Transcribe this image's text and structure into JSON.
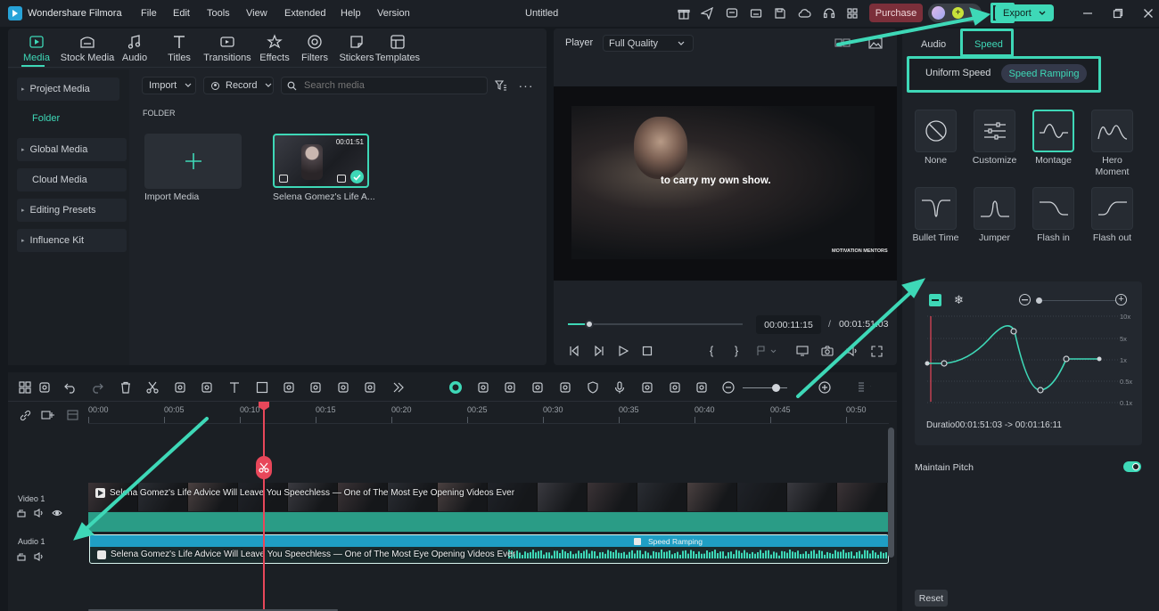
{
  "app": {
    "name": "Wondershare Filmora",
    "project_title": "Untitled"
  },
  "menu": [
    "File",
    "Edit",
    "Tools",
    "View",
    "Extended",
    "Help",
    "Version"
  ],
  "titlebar": {
    "purchase_label": "Purchase",
    "export_label": "Export"
  },
  "media_tabs": [
    {
      "label": "Media",
      "icon": "media-icon",
      "active": true
    },
    {
      "label": "Stock Media",
      "icon": "stock-media-icon"
    },
    {
      "label": "Audio",
      "icon": "audio-note-icon"
    },
    {
      "label": "Titles",
      "icon": "titles-icon"
    },
    {
      "label": "Transitions",
      "icon": "transitions-icon"
    },
    {
      "label": "Effects",
      "icon": "effects-icon"
    },
    {
      "label": "Filters",
      "icon": "filters-icon"
    },
    {
      "label": "Stickers",
      "icon": "stickers-icon"
    },
    {
      "label": "Templates",
      "icon": "templates-icon"
    }
  ],
  "sidebar": {
    "items": [
      {
        "label": "Project Media",
        "expandable": true
      },
      {
        "label": "Folder",
        "active": true
      },
      {
        "label": "Global Media",
        "expandable": true
      },
      {
        "label": "Cloud Media"
      },
      {
        "label": "Editing Presets",
        "expandable": true
      },
      {
        "label": "Influence Kit",
        "expandable": true
      }
    ]
  },
  "media_toolbar": {
    "import_label": "Import",
    "record_label": "Record",
    "search_placeholder": "Search media"
  },
  "folder_label": "FOLDER",
  "media_items": [
    {
      "label": "Import Media"
    },
    {
      "label": "Selena Gomez's Life A...",
      "duration": "00:01:51"
    }
  ],
  "player": {
    "label": "Player",
    "quality": "Full Quality",
    "subtitle": "to carry my own show.",
    "watermark": "MOTIVATION MENTORS",
    "current_time": "00:00:11:15",
    "separator": "/",
    "total_time": "00:01:51:03",
    "progress": 0.12
  },
  "right_panel": {
    "tabs": [
      {
        "label": "Audio"
      },
      {
        "label": "Speed",
        "active": true
      }
    ],
    "speed_modes": [
      {
        "label": "Uniform Speed"
      },
      {
        "label": "Speed Ramping",
        "active": true
      }
    ],
    "presets": [
      {
        "label": "None",
        "icon": "none-icon"
      },
      {
        "label": "Customize",
        "icon": "customize-icon"
      },
      {
        "label": "Montage",
        "icon": "montage-curve-icon",
        "selected": true
      },
      {
        "label": "Hero Moment",
        "icon": "hero-moment-curve-icon"
      },
      {
        "label": "Bullet Time",
        "icon": "bullet-time-curve-icon"
      },
      {
        "label": "Jumper",
        "icon": "jumper-curve-icon"
      },
      {
        "label": "Flash in",
        "icon": "flash-in-curve-icon"
      },
      {
        "label": "Flash out",
        "icon": "flash-out-curve-icon"
      }
    ],
    "graph_scale": [
      "10x",
      "5x",
      "1x",
      "0.5x",
      "0.1x"
    ],
    "duration_text": "Duratio00:01:51:03 -> 00:01:16:11",
    "maintain_pitch_label": "Maintain Pitch",
    "maintain_pitch_on": true,
    "reset_label": "Reset"
  },
  "timeline": {
    "ruler": [
      "00:00",
      "00:05",
      "00:10",
      "00:15",
      "00:20",
      "00:25",
      "00:30",
      "00:35",
      "00:40",
      "00:45",
      "00:50"
    ],
    "tracks": [
      {
        "name": "Video 1",
        "clip_title": "Selena Gomez's Life Advice Will Leave You Speechless — One of The Most Eye Opening Videos Ever"
      },
      {
        "name": "Audio 1",
        "clip_title": "Selena Gomez's Life Advice Will Leave You Speechless — One of The Most Eye Opening Videos Ever",
        "badge": "Speed Ramping"
      }
    ]
  },
  "colors": {
    "accent": "#3ed8b7",
    "playhead": "#e8475a",
    "purchase": "#8a3540",
    "audio_clip": "#1f9ec4",
    "video_track": "#2a9c86"
  }
}
